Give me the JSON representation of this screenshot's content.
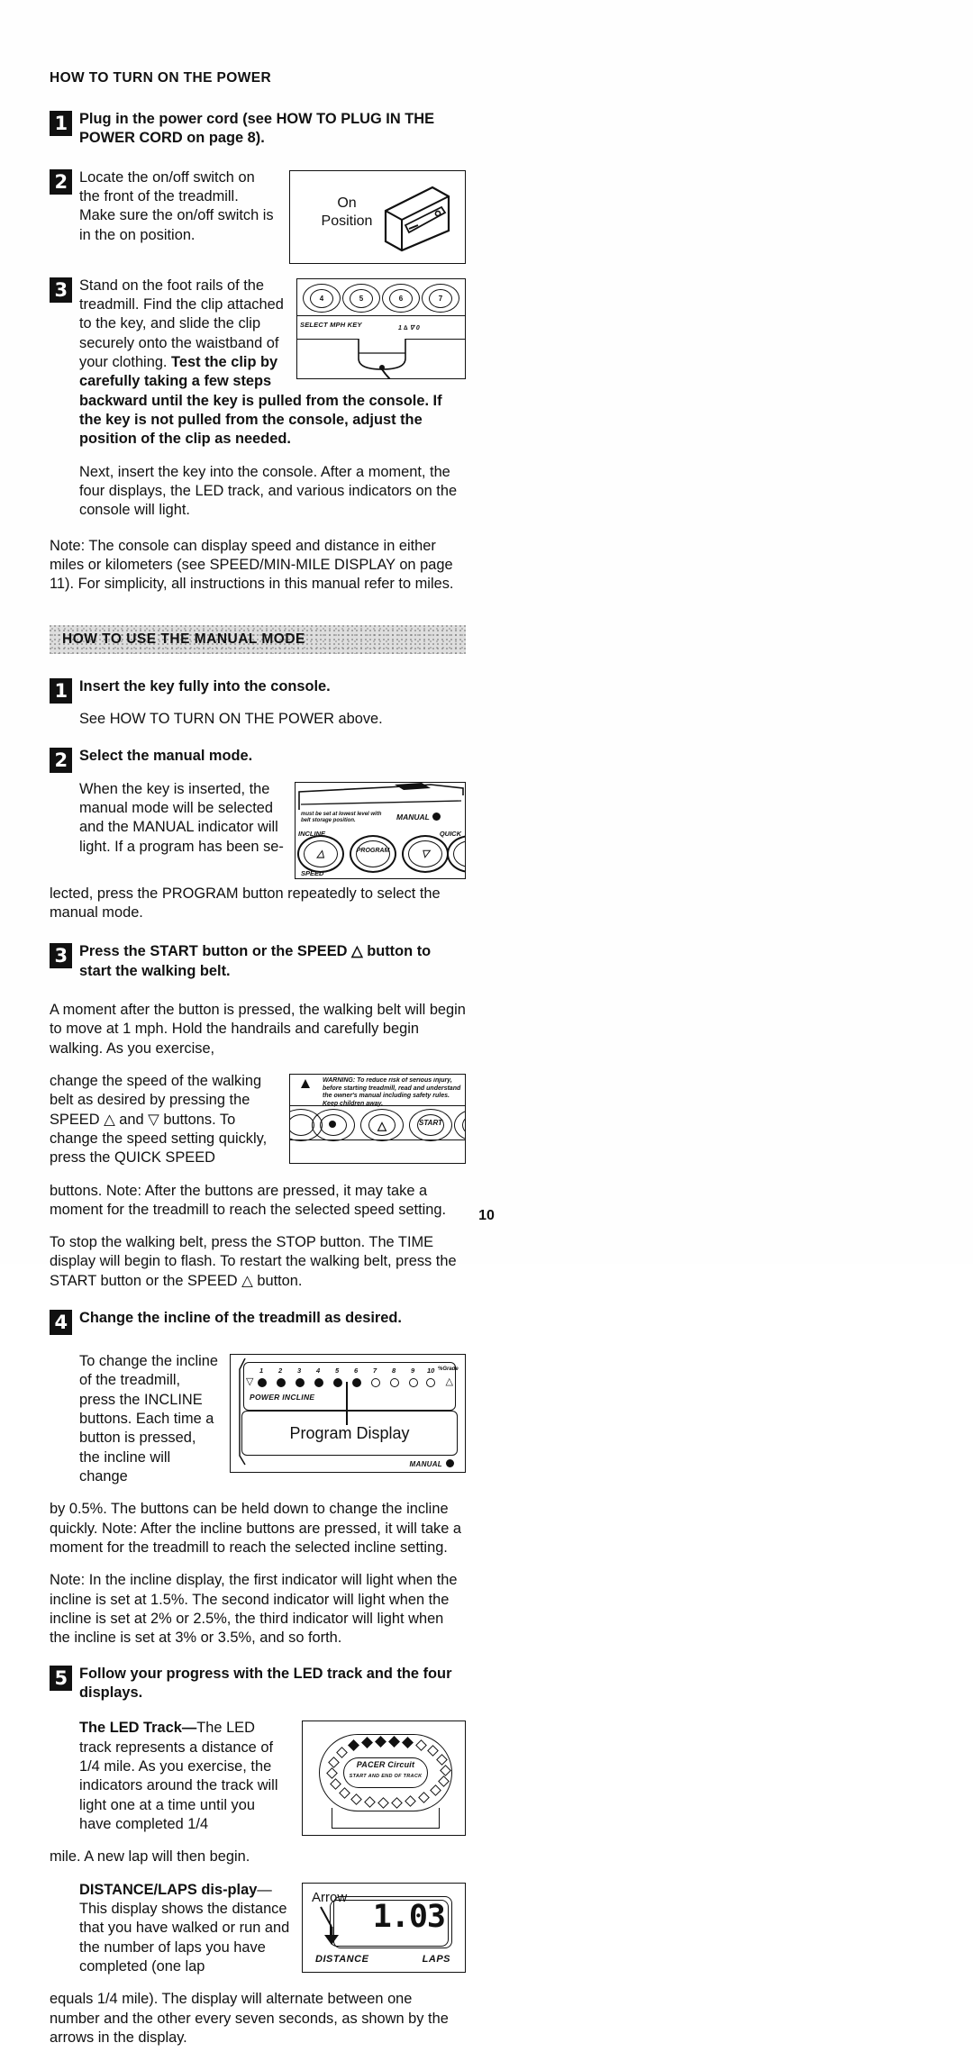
{
  "page": {
    "number": "10"
  },
  "left_column": {
    "heading": "HOW TO TURN ON THE POWER",
    "step1": {
      "num": "1",
      "text": "Plug in the power cord (see HOW TO PLUG IN THE POWER CORD on page 8)."
    },
    "step2": {
      "num": "2",
      "text": "Locate the on/off switch on the front of the treadmill. Make sure the on/off switch is in the on position.",
      "figure": {
        "name": "on-off-switch",
        "label_line1": "On",
        "label_line2": "Position"
      }
    },
    "step3": {
      "num": "3",
      "text_normal": "Stand on the foot rails of the treadmill. Find the clip attached to the key, and slide the clip securely onto the waistband of your clothing. ",
      "text_bold": "Test the clip by carefully taking a few steps backward until the key is pulled from the console. If the key is not pulled from the console, adjust the position of the clip as needed.",
      "figure": {
        "name": "console-key-clip",
        "button_labels": [
          "4",
          "5",
          "6",
          "7"
        ],
        "panel_text": "SELECT MPH KEY",
        "indicator_text": "1 ∆      ∇ 0"
      },
      "followup": "Next, insert the key into the console. After a moment, the four displays, the LED track, and various indicators on the console will light."
    },
    "note": "Note: The console can display speed and distance in either miles or kilometers (see SPEED/MIN-MILE DISPLAY on page 11). For simplicity, all instructions in this manual refer to miles.",
    "banner": "HOW TO USE THE MANUAL MODE",
    "manual_step1": {
      "num": "1",
      "text": "Insert the key fully into the console.",
      "followup": "See HOW TO TURN ON THE POWER above."
    },
    "manual_step2": {
      "num": "2",
      "text": "Select the manual mode.",
      "body_part1": "When the key is inserted, the manual mode will be selected and the MANUAL indicator will light. If a program has been se-",
      "body_part2": "lected, press the PROGRAM button repeatedly to select the manual mode.",
      "figure": {
        "name": "manual-mode-console",
        "tiny_text": "must be set at lowest level with belt storage position.",
        "manual_label": "MANUAL",
        "incline_label": "INCLINE",
        "program_label": "PROGRAM",
        "quick_label": "QUICK",
        "speed_label": "SPEED",
        "up_arrow": "△",
        "down_arrow": "▽"
      }
    },
    "manual_step3": {
      "num": "3",
      "text": "Press the START button or the SPEED △ button to start the walking belt.",
      "followup": "A moment after the button is pressed, the walking belt will begin to move at 1 mph. Hold the handrails and carefully begin walking. As you exercise,"
    }
  },
  "right_column": {
    "continued_part1": "change the speed of the walking belt as desired by pressing the SPEED △ and ▽ buttons. To change the speed setting quickly, press the QUICK SPEED ",
    "continued_part2": "buttons. Note: After the buttons are pressed, it may take a moment for the treadmill to reach the selected speed setting.",
    "warning_figure": {
      "name": "warning-label-console",
      "warning_word": "WARNING:",
      "warning_text": "To reduce risk of serious injury, before starting treadmill, read and understand the owner's manual including safety rules. Keep children away.",
      "start_label": "START",
      "up_arrow": "△"
    },
    "stop_para": "To stop the walking belt, press the STOP button. The TIME display will begin to flash. To restart the walking belt, press the START button or the SPEED △ button.",
    "step4": {
      "num": "4",
      "text": "Change the incline of the treadmill as desired.",
      "body_part1": "To change the incline of the treadmill, press the INCLINE buttons. Each time a button is pressed, the incline will change ",
      "body_part2": "by 0.5%. The buttons can be held down to change the incline quickly. Note: After the incline buttons are pressed, it will take a moment for the treadmill to reach the selected incline setting.",
      "figure": {
        "name": "program-display",
        "tick_numbers": [
          "1",
          "2",
          "3",
          "4",
          "5",
          "6",
          "7",
          "8",
          "9",
          "10"
        ],
        "grade_label": "%Grade",
        "power_incline_label": "POWER INCLINE",
        "display_label": "Program Display",
        "manual_label": "MANUAL",
        "down_arrow": "▽",
        "up_arrow": "△",
        "lit_count": 6
      }
    },
    "incline_note": "Note: In the incline display, the first indicator will light when the incline is set at 1.5%. The second indicator will light when the incline is set at 2% or 2.5%, the third indicator will light when the incline is set at 3% or 3.5%, and so forth.",
    "step5": {
      "num": "5",
      "text": "Follow your progress with the LED track and the four displays.",
      "led_heading": "The LED Track—",
      "led_part1": "The LED track represents a distance of 1/4 mile. As you exercise, the indicators around the track will light one at a time until you have completed 1/4 ",
      "led_part2": "mile. A new lap will then begin.",
      "track_figure": {
        "name": "led-track",
        "brand": "PACER Circuit",
        "sub_label": "START AND END OF TRACK"
      },
      "dist_heading": "DISTANCE/LAPS dis-",
      "dist_heading2": "play",
      "dist_part1": "—This display shows the distance that you have walked or run and the number of laps you have completed (one lap ",
      "dist_part2": "equals 1/4 mile). The display will alternate between one number and the other every seven seconds, as shown by the arrows in the display.",
      "dist_figure": {
        "name": "distance-laps-display",
        "arrow_label": "Arrow",
        "value": "1.03",
        "left_label": "DISTANCE",
        "right_label": "LAPS"
      }
    }
  }
}
